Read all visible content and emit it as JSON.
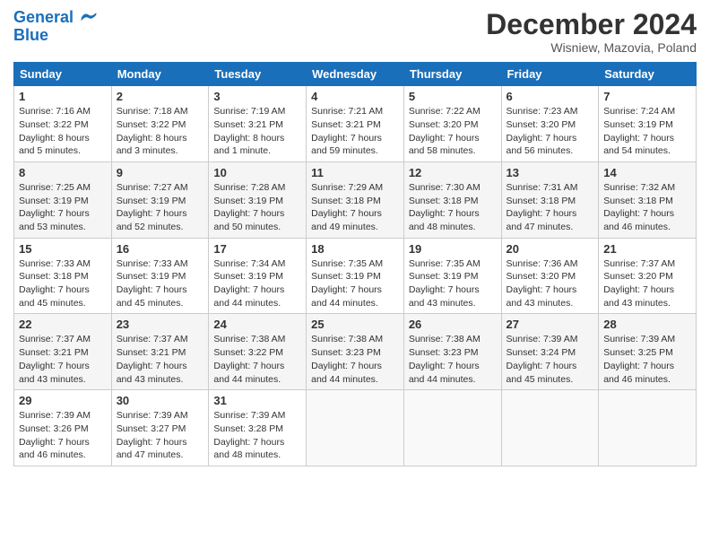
{
  "header": {
    "logo_line1": "General",
    "logo_line2": "Blue",
    "month_title": "December 2024",
    "subtitle": "Wisniew, Mazovia, Poland"
  },
  "days_of_week": [
    "Sunday",
    "Monday",
    "Tuesday",
    "Wednesday",
    "Thursday",
    "Friday",
    "Saturday"
  ],
  "weeks": [
    [
      {
        "day": 1,
        "sunrise": "7:16 AM",
        "sunset": "3:22 PM",
        "daylight": "8 hours and 5 minutes."
      },
      {
        "day": 2,
        "sunrise": "7:18 AM",
        "sunset": "3:22 PM",
        "daylight": "8 hours and 3 minutes."
      },
      {
        "day": 3,
        "sunrise": "7:19 AM",
        "sunset": "3:21 PM",
        "daylight": "8 hours and 1 minute."
      },
      {
        "day": 4,
        "sunrise": "7:21 AM",
        "sunset": "3:21 PM",
        "daylight": "7 hours and 59 minutes."
      },
      {
        "day": 5,
        "sunrise": "7:22 AM",
        "sunset": "3:20 PM",
        "daylight": "7 hours and 58 minutes."
      },
      {
        "day": 6,
        "sunrise": "7:23 AM",
        "sunset": "3:20 PM",
        "daylight": "7 hours and 56 minutes."
      },
      {
        "day": 7,
        "sunrise": "7:24 AM",
        "sunset": "3:19 PM",
        "daylight": "7 hours and 54 minutes."
      }
    ],
    [
      {
        "day": 8,
        "sunrise": "7:25 AM",
        "sunset": "3:19 PM",
        "daylight": "7 hours and 53 minutes."
      },
      {
        "day": 9,
        "sunrise": "7:27 AM",
        "sunset": "3:19 PM",
        "daylight": "7 hours and 52 minutes."
      },
      {
        "day": 10,
        "sunrise": "7:28 AM",
        "sunset": "3:19 PM",
        "daylight": "7 hours and 50 minutes."
      },
      {
        "day": 11,
        "sunrise": "7:29 AM",
        "sunset": "3:18 PM",
        "daylight": "7 hours and 49 minutes."
      },
      {
        "day": 12,
        "sunrise": "7:30 AM",
        "sunset": "3:18 PM",
        "daylight": "7 hours and 48 minutes."
      },
      {
        "day": 13,
        "sunrise": "7:31 AM",
        "sunset": "3:18 PM",
        "daylight": "7 hours and 47 minutes."
      },
      {
        "day": 14,
        "sunrise": "7:32 AM",
        "sunset": "3:18 PM",
        "daylight": "7 hours and 46 minutes."
      }
    ],
    [
      {
        "day": 15,
        "sunrise": "7:33 AM",
        "sunset": "3:18 PM",
        "daylight": "7 hours and 45 minutes."
      },
      {
        "day": 16,
        "sunrise": "7:33 AM",
        "sunset": "3:19 PM",
        "daylight": "7 hours and 45 minutes."
      },
      {
        "day": 17,
        "sunrise": "7:34 AM",
        "sunset": "3:19 PM",
        "daylight": "7 hours and 44 minutes."
      },
      {
        "day": 18,
        "sunrise": "7:35 AM",
        "sunset": "3:19 PM",
        "daylight": "7 hours and 44 minutes."
      },
      {
        "day": 19,
        "sunrise": "7:35 AM",
        "sunset": "3:19 PM",
        "daylight": "7 hours and 43 minutes."
      },
      {
        "day": 20,
        "sunrise": "7:36 AM",
        "sunset": "3:20 PM",
        "daylight": "7 hours and 43 minutes."
      },
      {
        "day": 21,
        "sunrise": "7:37 AM",
        "sunset": "3:20 PM",
        "daylight": "7 hours and 43 minutes."
      }
    ],
    [
      {
        "day": 22,
        "sunrise": "7:37 AM",
        "sunset": "3:21 PM",
        "daylight": "7 hours and 43 minutes."
      },
      {
        "day": 23,
        "sunrise": "7:37 AM",
        "sunset": "3:21 PM",
        "daylight": "7 hours and 43 minutes."
      },
      {
        "day": 24,
        "sunrise": "7:38 AM",
        "sunset": "3:22 PM",
        "daylight": "7 hours and 44 minutes."
      },
      {
        "day": 25,
        "sunrise": "7:38 AM",
        "sunset": "3:23 PM",
        "daylight": "7 hours and 44 minutes."
      },
      {
        "day": 26,
        "sunrise": "7:38 AM",
        "sunset": "3:23 PM",
        "daylight": "7 hours and 44 minutes."
      },
      {
        "day": 27,
        "sunrise": "7:39 AM",
        "sunset": "3:24 PM",
        "daylight": "7 hours and 45 minutes."
      },
      {
        "day": 28,
        "sunrise": "7:39 AM",
        "sunset": "3:25 PM",
        "daylight": "7 hours and 46 minutes."
      }
    ],
    [
      {
        "day": 29,
        "sunrise": "7:39 AM",
        "sunset": "3:26 PM",
        "daylight": "7 hours and 46 minutes."
      },
      {
        "day": 30,
        "sunrise": "7:39 AM",
        "sunset": "3:27 PM",
        "daylight": "7 hours and 47 minutes."
      },
      {
        "day": 31,
        "sunrise": "7:39 AM",
        "sunset": "3:28 PM",
        "daylight": "7 hours and 48 minutes."
      },
      null,
      null,
      null,
      null
    ]
  ]
}
